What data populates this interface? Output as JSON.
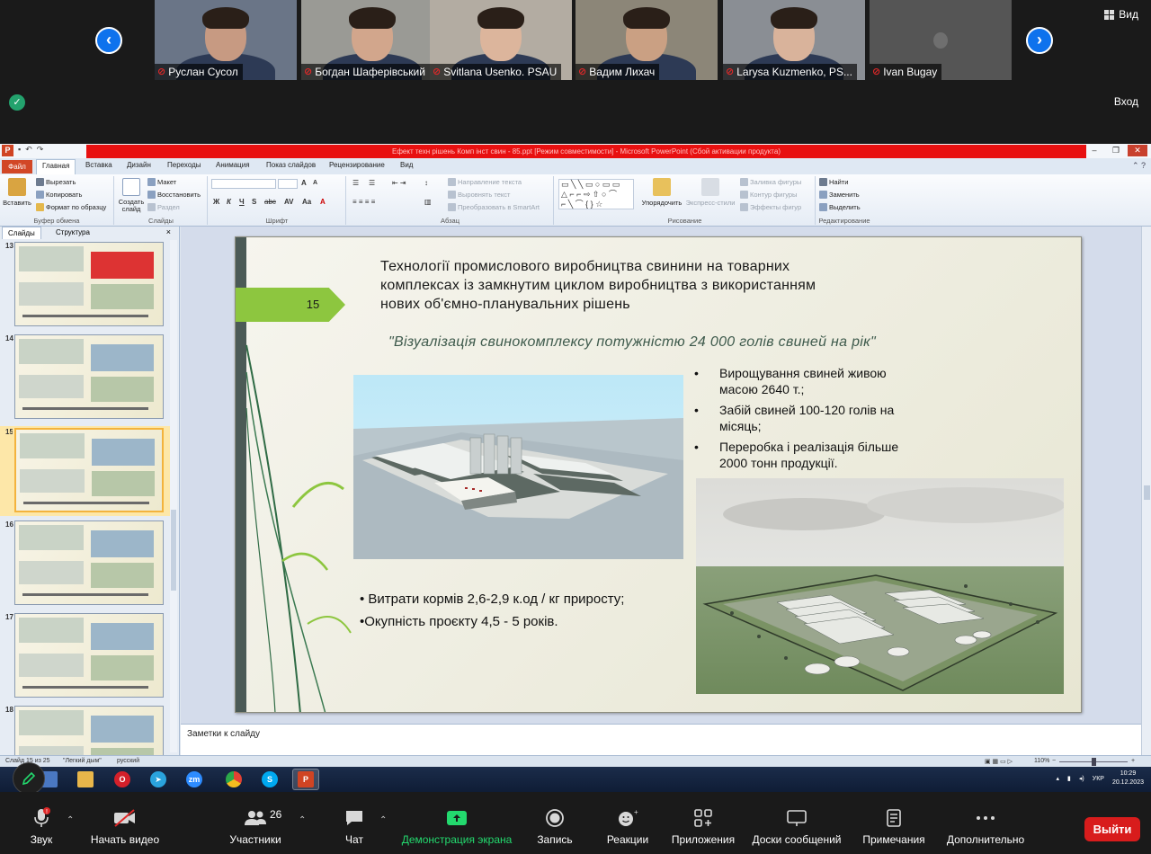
{
  "zoom": {
    "participants_tiles": [
      {
        "name": "Руслан Сусол",
        "tone": "#c79a82",
        "bg": "#6a7587"
      },
      {
        "name": "Богдан Шаферівський",
        "tone": "#d2a68c",
        "bg": "#9a9a95"
      },
      {
        "name": "Svitlana Usenko. PSAU",
        "tone": "#dcb59c",
        "bg": "#b3aca2"
      },
      {
        "name": "Вадим Лихач",
        "tone": "#caa083",
        "bg": "#8c8678"
      },
      {
        "name": "Larysa Kuzmenko, PS...",
        "tone": "#d9b39b",
        "bg": "#8a8e94"
      },
      {
        "name": "Ivan Bugay",
        "tone": "#6e6e6e",
        "bg": "#555555"
      }
    ],
    "view_label": "Вид",
    "login_label": "Вход",
    "toolbar": {
      "audio": "Звук",
      "video": "Начать видео",
      "participants": "Участники",
      "participants_count": "26",
      "chat": "Чат",
      "share": "Демонстрация экрана",
      "record": "Запись",
      "reactions": "Реакции",
      "apps": "Приложения",
      "whiteboards": "Доски сообщений",
      "notes": "Примечания",
      "more": "Дополнительно",
      "leave": "Выйти"
    }
  },
  "ppt": {
    "window_title": "Ефект техн рішень Комп інст свин - 85.ppt [Режим совместимости] - Microsoft PowerPoint (Сбой активации продукта)",
    "tabs": {
      "file": "Файл",
      "home": "Главная",
      "insert": "Вставка",
      "design": "Дизайн",
      "transitions": "Переходы",
      "animation": "Анимация",
      "slideshow": "Показ слайдов",
      "review": "Рецензирование",
      "view": "Вид"
    },
    "ribbon": {
      "clipboard": {
        "paste": "Вставить",
        "cut": "Вырезать",
        "copy": "Копировать",
        "format_painter": "Формат по образцу",
        "label": "Буфер обмена"
      },
      "slides": {
        "new_slide": "Создать слайд",
        "layout": "Макет",
        "reset": "Восстановить",
        "section": "Раздел",
        "label": "Слайды"
      },
      "font": {
        "label": "Шрифт",
        "size_up": "A",
        "size_down": "A"
      },
      "paragraph": {
        "text_direction": "Направление текста",
        "align_text": "Выровнять текст",
        "smartart": "Преобразовать в SmartArt",
        "label": "Абзац"
      },
      "drawing": {
        "arrange": "Упорядочить",
        "quick_styles": "Экспресс-стили",
        "shape_fill": "Заливка фигуры",
        "shape_outline": "Контур фигуры",
        "shape_effects": "Эффекты фигур",
        "label": "Рисование"
      },
      "editing": {
        "find": "Найти",
        "replace": "Заменить",
        "select": "Выделить",
        "label": "Редактирование"
      }
    },
    "panel": {
      "tab_slides": "Слайды",
      "tab_outline": "Структура",
      "close": "×",
      "thumbs": [
        "13",
        "14",
        "15",
        "16",
        "17",
        "18"
      ]
    },
    "slide": {
      "number": "15",
      "title_lines": [
        "Технології промислового виробництва свинини на товарних",
        "комплексах із замкнутим циклом виробництва з використанням",
        "нових об'ємно-планувальних рішень"
      ],
      "subtitle": "\"Візуалізація  свинокомплексу  потужністю  24 000 голів свиней на рік\"",
      "bullets": [
        "Вирощування свиней живою масою 2640 т.;",
        "Забій свиней 100-120 голів на місяць;",
        "Переробка і реалізація більше 2000 тонн продукції."
      ],
      "costs": [
        "• Витрати кормів 2,6-2,9 к.од / кг приросту;",
        "•Окупність  проєкту  4,5  - 5 років."
      ]
    },
    "notes_placeholder": "Заметки к слайду",
    "status": {
      "slide_of": "Слайд 15 из 25",
      "theme": "\"Легкий дым\"",
      "language": "русский",
      "zoom": "110%"
    }
  },
  "taskbar": {
    "lang": "УКР",
    "time": "10:29",
    "date": "20.12.2023"
  }
}
